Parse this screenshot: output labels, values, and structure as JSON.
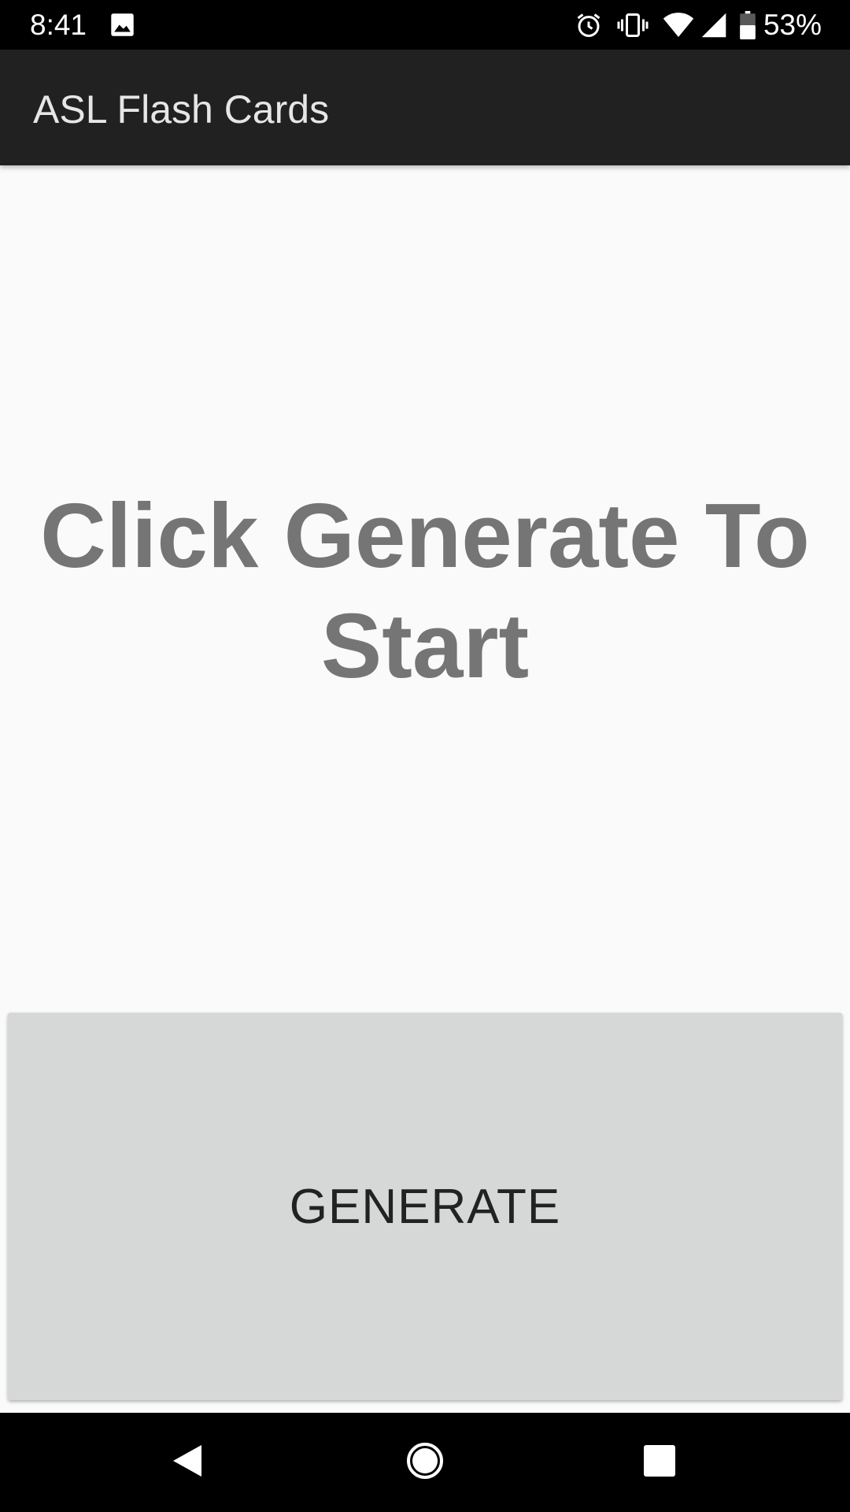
{
  "status_bar": {
    "time": "8:41",
    "battery_percent": "53%",
    "icons": [
      "image-icon",
      "alarm-icon",
      "vibrate-icon",
      "wifi-icon",
      "cell-signal-icon",
      "battery-icon"
    ]
  },
  "app_bar": {
    "title": "ASL Flash Cards"
  },
  "main": {
    "prompt": "Click Generate To Start",
    "generate_label": "GENERATE"
  },
  "nav_bar": {
    "icons": [
      "back-icon",
      "home-icon",
      "recents-icon"
    ]
  },
  "colors": {
    "status_bar_bg": "#000000",
    "app_bar_bg": "#212121",
    "page_bg": "#fafafa",
    "prompt_text": "#757575",
    "button_bg": "#d6d7d7",
    "button_text": "#222222"
  }
}
